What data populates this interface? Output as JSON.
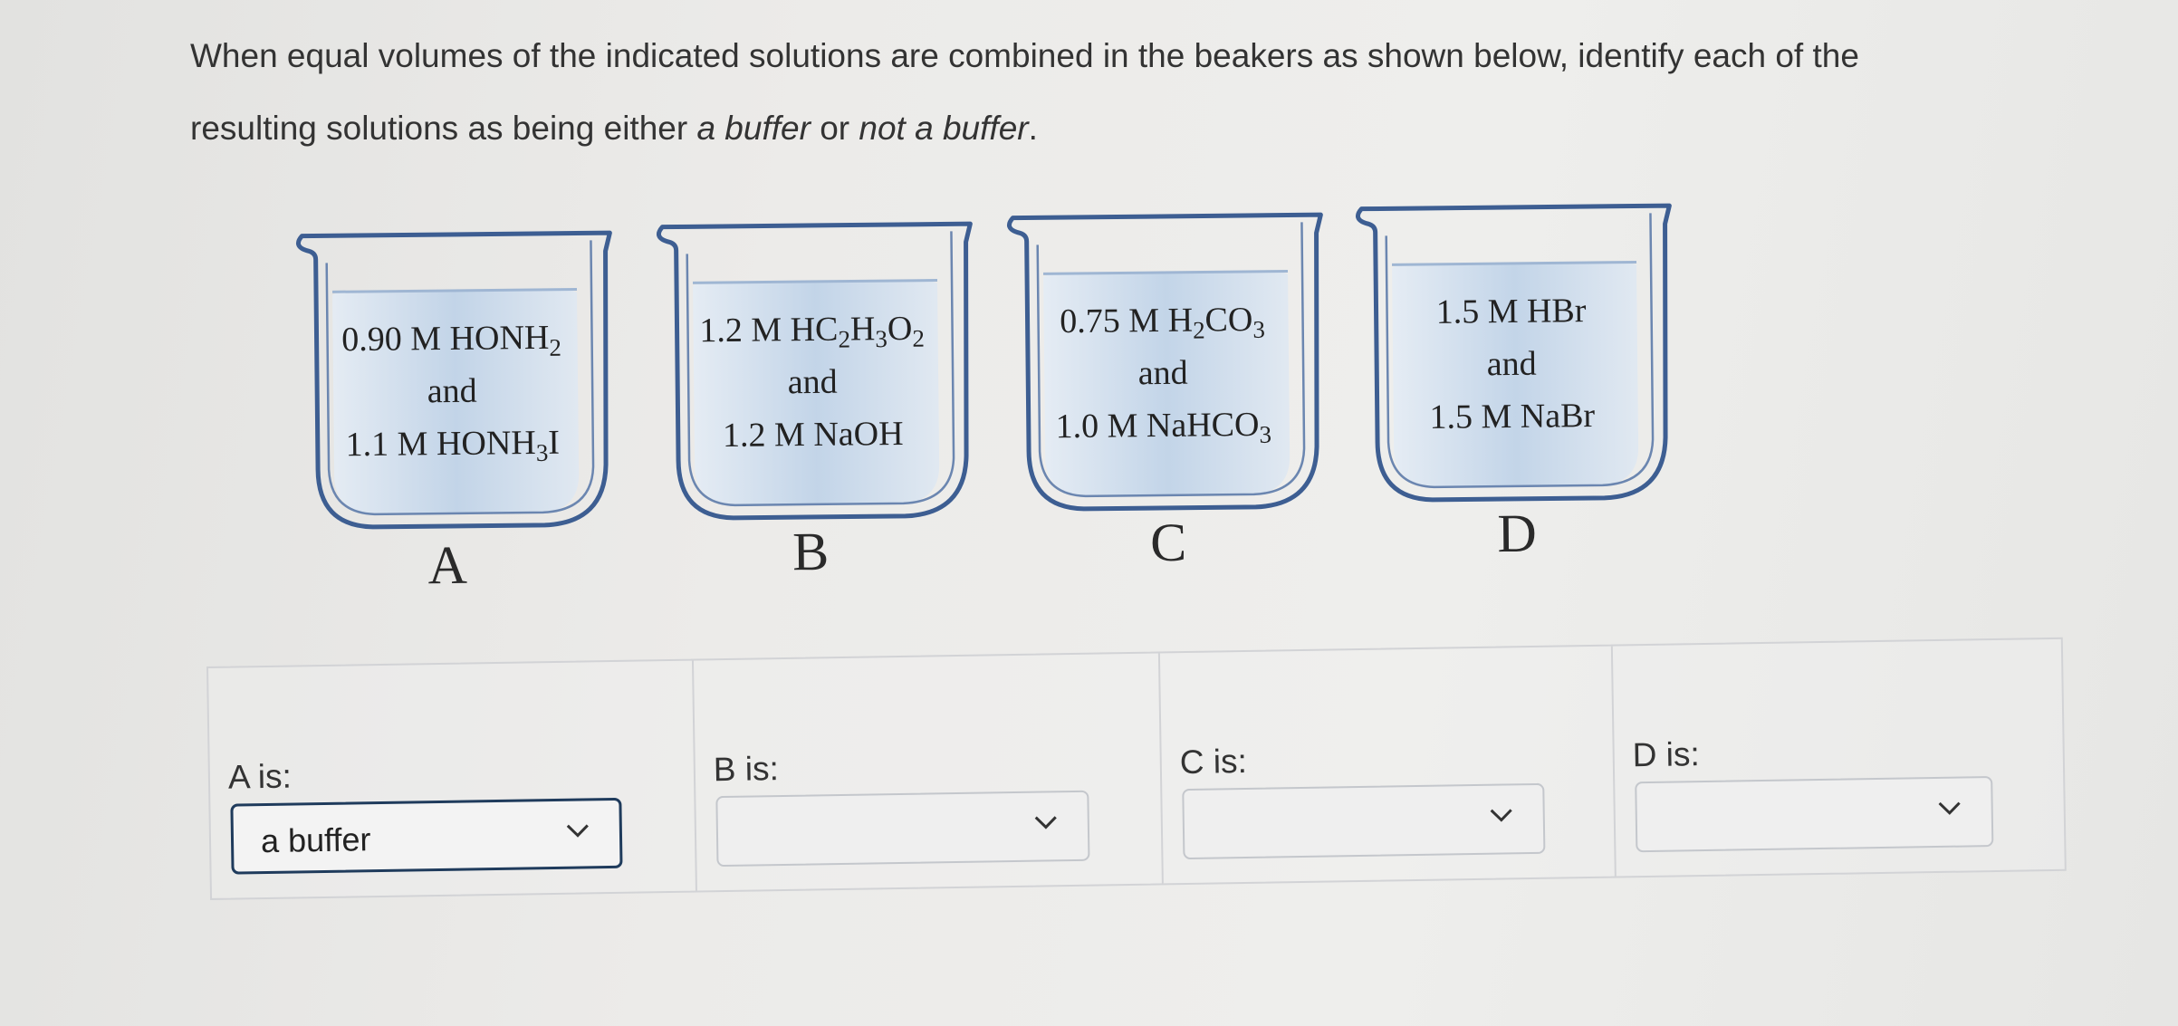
{
  "question": {
    "part1": "When equal volumes of the indicated solutions are combined in the beakers as shown below, identify each of the",
    "part2": "resulting solutions as being either ",
    "option1": "a buffer",
    "part3": " or ",
    "option2": "not a buffer",
    "part4": "."
  },
  "beakers": [
    {
      "letter": "A",
      "line1": {
        "a": "0.90 M HONH",
        "s": "2",
        "b": ""
      },
      "line2": "and",
      "line3": {
        "a": "1.1 M HONH",
        "s": "3",
        "b": "I"
      }
    },
    {
      "letter": "B",
      "line1": {
        "a": "1.2 M HC",
        "s1": "2",
        "b": "H",
        "s2": "3",
        "c": "O",
        "s3": "2"
      },
      "line2": "and",
      "line3": {
        "a": "1.2 M NaOH"
      }
    },
    {
      "letter": "C",
      "line1": {
        "a": "0.75 M H",
        "s1": "2",
        "b": "CO",
        "s2": "3"
      },
      "line2": "and",
      "line3": {
        "a": "1.0 M NaHCO",
        "s": "3"
      }
    },
    {
      "letter": "D",
      "line1": {
        "a": "1.5 M HBr"
      },
      "line2": "and",
      "line3": {
        "a": "1.5 M NaBr"
      }
    }
  ],
  "answers": [
    {
      "label": "A is:",
      "value": "a buffer",
      "icon": "chevron-down-icon"
    },
    {
      "label": "B is:",
      "value": "",
      "icon": "chevron-down-icon"
    },
    {
      "label": "C is:",
      "value": "",
      "icon": "chevron-down-icon"
    },
    {
      "label": "D is:",
      "value": "",
      "icon": "chevron-down-icon"
    }
  ],
  "colors": {
    "beaker_outline": "#3d5e92",
    "liquid": "#c9d9ea",
    "active_select_border": "#1f3b5c",
    "panel_border": "#d2d3d6"
  }
}
